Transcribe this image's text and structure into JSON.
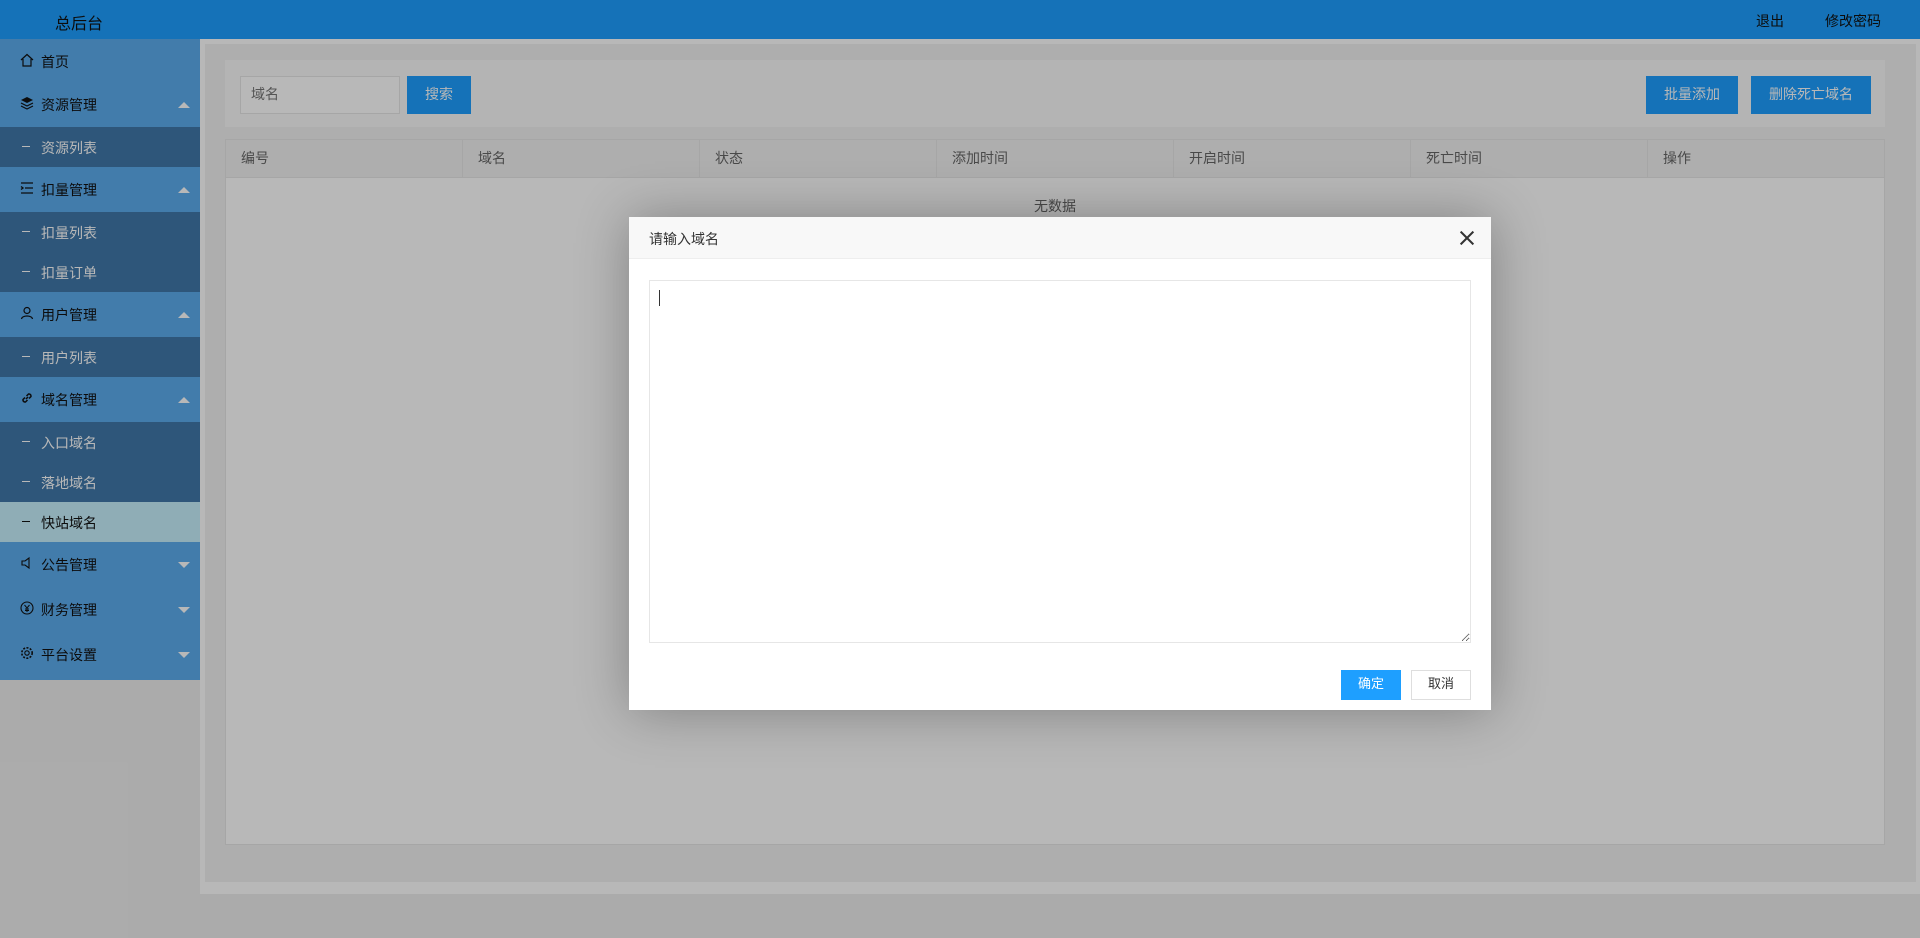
{
  "header": {
    "title": "总后台",
    "logout": "退出",
    "change_password": "修改密码"
  },
  "sidebar": {
    "home": {
      "label": "首页",
      "icon": "home-icon"
    },
    "groups": [
      {
        "label": "资源管理",
        "icon": "layers-icon",
        "expanded": true,
        "children": [
          "资源列表"
        ]
      },
      {
        "label": "扣量管理",
        "icon": "list-icon",
        "expanded": true,
        "children": [
          "扣量列表",
          "扣量订单"
        ]
      },
      {
        "label": "用户管理",
        "icon": "user-icon",
        "expanded": true,
        "children": [
          "用户列表"
        ]
      },
      {
        "label": "域名管理",
        "icon": "link-icon",
        "expanded": true,
        "children": [
          "入口域名",
          "落地域名",
          "快站域名"
        ]
      },
      {
        "label": "公告管理",
        "icon": "speaker-icon",
        "expanded": false,
        "children": []
      },
      {
        "label": "财务管理",
        "icon": "yen-icon",
        "expanded": false,
        "children": []
      },
      {
        "label": "平台设置",
        "icon": "gear-icon",
        "expanded": false,
        "children": []
      }
    ],
    "active_child": "快站域名"
  },
  "toolbar": {
    "search_placeholder": "域名",
    "search_button": "搜索",
    "batch_add_button": "批量添加",
    "delete_dead_button": "删除死亡域名"
  },
  "table": {
    "columns": [
      "编号",
      "域名",
      "状态",
      "添加时间",
      "开启时间",
      "死亡时间",
      "操作"
    ],
    "empty_text": "无数据"
  },
  "modal": {
    "title": "请输入域名",
    "textarea_value": "",
    "confirm_button": "确定",
    "cancel_button": "取消"
  }
}
